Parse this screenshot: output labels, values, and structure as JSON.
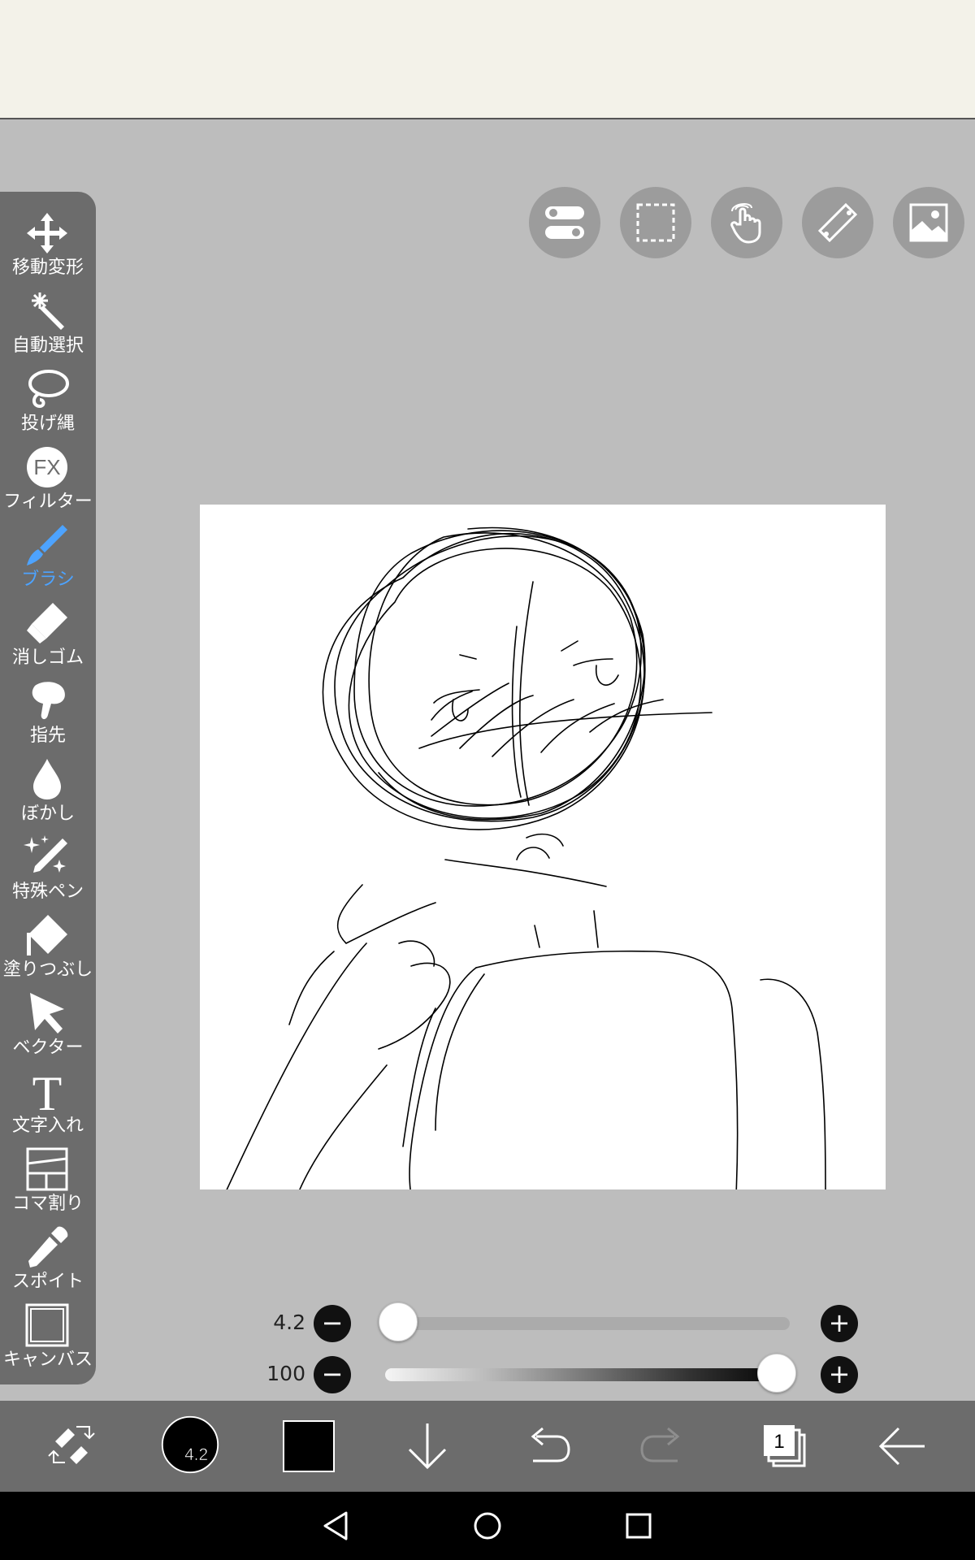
{
  "tools": [
    {
      "id": "move",
      "label": "移動変形",
      "icon": "move-icon",
      "active": false
    },
    {
      "id": "auto-select",
      "label": "自動選択",
      "icon": "magic-wand-icon",
      "active": false
    },
    {
      "id": "lasso",
      "label": "投げ縄",
      "icon": "lasso-icon",
      "active": false
    },
    {
      "id": "filter",
      "label": "フィルター",
      "icon": "fx-icon",
      "fx_text": "FX",
      "active": false
    },
    {
      "id": "brush",
      "label": "ブラシ",
      "icon": "brush-icon",
      "active": true
    },
    {
      "id": "eraser",
      "label": "消しゴム",
      "icon": "eraser-icon",
      "active": false
    },
    {
      "id": "finger",
      "label": "指先",
      "icon": "finger-icon",
      "active": false
    },
    {
      "id": "blur",
      "label": "ぼかし",
      "icon": "blur-drop-icon",
      "active": false
    },
    {
      "id": "special-pen",
      "label": "特殊ペン",
      "icon": "special-pen-icon",
      "active": false
    },
    {
      "id": "fill",
      "label": "塗りつぶし",
      "icon": "fill-bucket-icon",
      "active": false
    },
    {
      "id": "vector",
      "label": "ベクター",
      "icon": "vector-cursor-icon",
      "active": false
    },
    {
      "id": "text",
      "label": "文字入れ",
      "icon": "text-icon",
      "text_glyph": "T",
      "active": false
    },
    {
      "id": "frame",
      "label": "コマ割り",
      "icon": "frame-divider-icon",
      "active": false
    },
    {
      "id": "eyedropper",
      "label": "スポイト",
      "icon": "eyedropper-icon",
      "active": false
    },
    {
      "id": "canvas",
      "label": "キャンバス",
      "icon": "canvas-icon",
      "active": false
    }
  ],
  "top_buttons": [
    {
      "id": "toggle",
      "icon": "toggle-switch-icon"
    },
    {
      "id": "selection",
      "icon": "selection-rect-icon"
    },
    {
      "id": "gesture",
      "icon": "hand-gesture-icon"
    },
    {
      "id": "ruler",
      "icon": "ruler-icon"
    },
    {
      "id": "material",
      "icon": "image-material-icon"
    }
  ],
  "brush_size": {
    "value": "4.2",
    "position": 0.0
  },
  "opacity": {
    "value": "100",
    "position": 1.0
  },
  "minus_glyph": "−",
  "plus_glyph": "+",
  "bottom_toolbar": {
    "color_swap_icon": "color-swap-icon",
    "brush_size_label": "4.2",
    "current_color": "#000000",
    "layers_count": "1"
  },
  "colors": {
    "panel": "#6c6c6c",
    "workspace": "#bdbdbd",
    "active_tool": "#4da3ff",
    "top_bar": "#f3f2e9"
  }
}
